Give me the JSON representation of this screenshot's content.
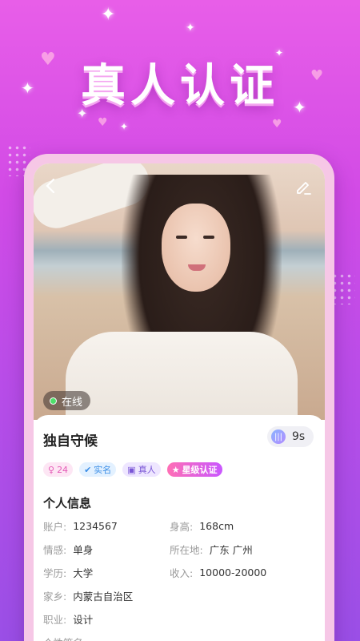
{
  "header": {
    "title": "真人认证"
  },
  "profile": {
    "online_label": "在线",
    "name": "独自守候",
    "voice_duration": "9s",
    "tags": {
      "age": "24",
      "realname": "实名",
      "real_person": "真人",
      "star": "星级认证"
    }
  },
  "info": {
    "section_title": "个人信息",
    "account_label": "账户:",
    "account_value": "1234567",
    "height_label": "身高:",
    "height_value": "168cm",
    "relationship_label": "情感:",
    "relationship_value": "单身",
    "location_label": "所在地:",
    "location_value": "广东 广州",
    "education_label": "学历:",
    "education_value": "大学",
    "income_label": "收入:",
    "income_value": "10000-20000",
    "hometown_label": "家乡:",
    "hometown_value": "内蒙古自治区",
    "job_label": "职业:",
    "job_value": "设计",
    "signature_label": "个性签名:"
  },
  "colors": {
    "accent_pink": "#e85ee8",
    "accent_purple": "#9a4fe6",
    "online_green": "#4ee06a"
  }
}
